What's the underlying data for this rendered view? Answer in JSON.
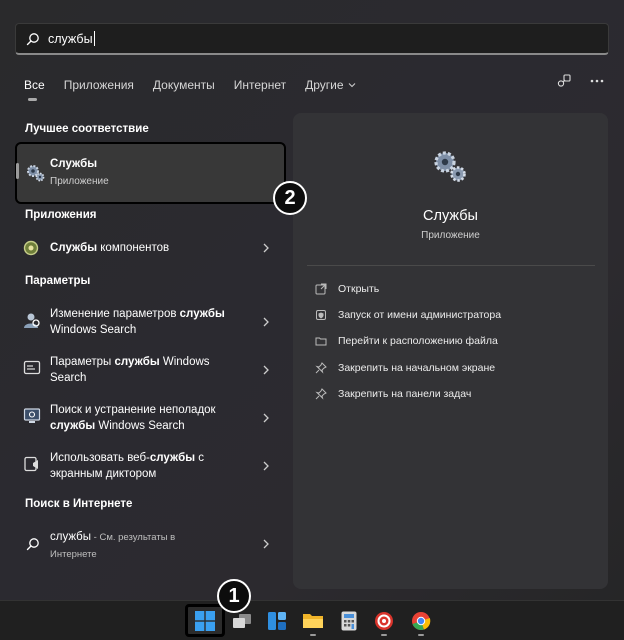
{
  "search": {
    "value": "службы"
  },
  "tabs": [
    {
      "label": "Все"
    },
    {
      "label": "Приложения"
    },
    {
      "label": "Документы"
    },
    {
      "label": "Интернет"
    },
    {
      "label": "Другие"
    }
  ],
  "sections": {
    "best": "Лучшее соответствие",
    "apps": "Приложения",
    "settings": "Параметры",
    "web": "Поиск в Интернете"
  },
  "best_match": {
    "title": "Службы",
    "subtitle": "Приложение"
  },
  "apps": [
    {
      "bold": "Службы",
      "rest": " компонентов"
    }
  ],
  "settings": [
    {
      "pre": "Изменение параметров ",
      "bold": "службы",
      "post": "",
      "line2": "Windows Search"
    },
    {
      "pre": "Параметры ",
      "bold": "службы",
      "post": " Windows",
      "line2": "Search"
    },
    {
      "pre": "Поиск и устранение неполадок",
      "bold": "",
      "post": "",
      "line2pre": "",
      "line2bold": "службы",
      "line2": " Windows Search"
    },
    {
      "pre": "Использовать веб-",
      "bold": "службы",
      "post": " с",
      "line2": "экранным диктором"
    }
  ],
  "web": {
    "query": "службы",
    "hint": " - См. результаты в",
    "hint2": "Интернете"
  },
  "preview": {
    "title": "Службы",
    "subtitle": "Приложение",
    "actions": [
      {
        "label": "Открыть",
        "icon": "open-icon"
      },
      {
        "label": "Запуск от имени администратора",
        "icon": "shield-icon"
      },
      {
        "label": "Перейти к расположению файла",
        "icon": "folder-icon"
      },
      {
        "label": "Закрепить на начальном экране",
        "icon": "pin-icon"
      },
      {
        "label": "Закрепить на панели задач",
        "icon": "pin-icon"
      }
    ]
  },
  "callouts": {
    "one": "1",
    "two": "2"
  },
  "colors": {
    "accent": "#0078d4",
    "panel": "#2b2a2f",
    "preview": "#333336"
  }
}
